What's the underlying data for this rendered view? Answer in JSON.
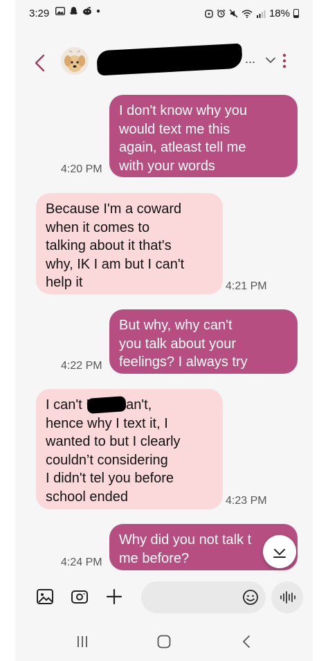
{
  "status_bar": {
    "time": "3:29",
    "battery": "18%",
    "left_icons": [
      "gallery-icon",
      "snapchat-icon",
      "reddit-icon",
      "dot-icon"
    ],
    "right_icons": [
      "alarm-icon",
      "alarm-clock-icon",
      "mute-icon",
      "wifi-icon",
      "signal-icon",
      "battery-icon"
    ]
  },
  "header": {
    "contact_name": "",
    "ellipsis": "..."
  },
  "messages": [
    {
      "direction": "sent",
      "text": "I don't know why you\nwould text me this\nagain, atleast tell me\nwith your words",
      "time": "4:20 PM"
    },
    {
      "direction": "received",
      "text": "Because I'm a coward\nwhen it comes to\ntalking about it that's\nwhy, IK I am but I can't\nhelp it",
      "time": "4:21 PM"
    },
    {
      "direction": "sent",
      "text": "But why, why can't\nyou talk about your\nfeelings? I always try",
      "time": "4:22 PM"
    },
    {
      "direction": "received",
      "text": "I can't           I just can't,\nhence why I text it, I\nwanted to but I clearly\ncouldn’t considering\nI didn't tel you before\nschool ended",
      "time": "4:23 PM"
    },
    {
      "direction": "sent",
      "text": "Why did you not talk t\nme before?",
      "time": "4:24 PM"
    }
  ],
  "composer": {
    "placeholder": "",
    "icons": [
      "gallery-icon",
      "camera-icon",
      "plus-icon",
      "emoji-icon",
      "voice-icon"
    ]
  },
  "nav": {
    "buttons": [
      "recents-icon",
      "home-icon",
      "back-icon"
    ]
  },
  "colors": {
    "sent_bubble": "#b64e82",
    "received_bubble": "#fbd9da",
    "accent": "#a33a5a"
  }
}
